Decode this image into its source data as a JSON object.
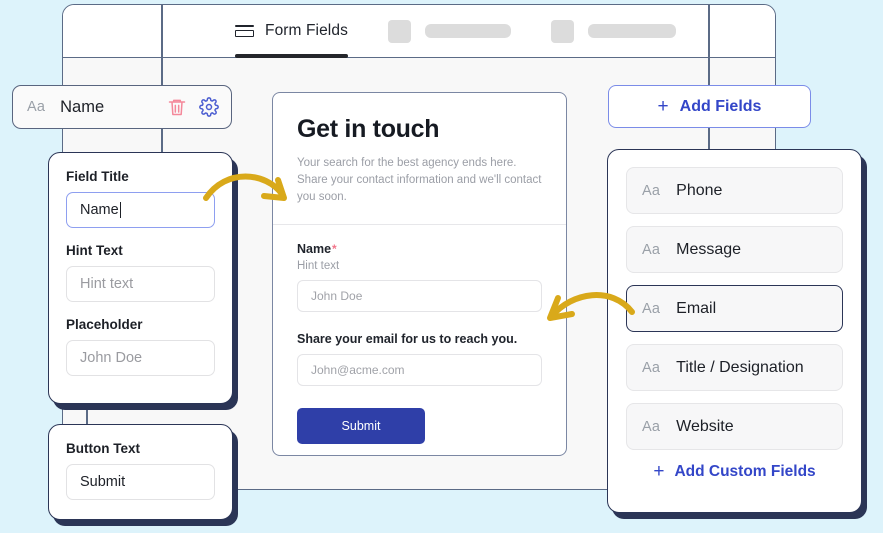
{
  "app": {
    "tabs": [
      {
        "label": "Form Fields",
        "icon": "form-icon",
        "active": true
      },
      {
        "label": "",
        "icon": "skeleton",
        "active": false
      },
      {
        "label": "",
        "icon": "skeleton",
        "active": false
      }
    ]
  },
  "field_chip": {
    "type_icon": "Aa",
    "label": "Name",
    "delete_icon": "trash-icon",
    "settings_icon": "gear-icon",
    "delete_color": "#f4889a",
    "settings_color": "#4a5cd0"
  },
  "settings_panel": {
    "field_title_label": "Field Title",
    "field_title_value": "Name",
    "hint_text_label": "Hint Text",
    "hint_text_placeholder": "Hint text",
    "placeholder_label": "Placeholder",
    "placeholder_placeholder": "John Doe"
  },
  "button_panel": {
    "label": "Button Text",
    "value": "Submit"
  },
  "preview": {
    "title": "Get in touch",
    "description": "Your search for the best agency ends here. Share your contact information and we'll contact you soon.",
    "name_label": "Name",
    "required_mark": "*",
    "name_hint": "Hint text",
    "name_placeholder": "John Doe",
    "email_label": "Share your email for us to reach you.",
    "email_placeholder": "John@acme.com",
    "submit_label": "Submit",
    "submit_color": "#2f3fa8"
  },
  "add_fields_button": {
    "plus": "+",
    "label": "Add Fields",
    "color": "#3346c8"
  },
  "fields_panel": {
    "items": [
      {
        "type_icon": "Aa",
        "label": "Phone",
        "selected": false
      },
      {
        "type_icon": "Aa",
        "label": "Message",
        "selected": false
      },
      {
        "type_icon": "Aa",
        "label": "Email",
        "selected": true
      },
      {
        "type_icon": "Aa",
        "label": "Title / Designation",
        "selected": false
      },
      {
        "type_icon": "Aa",
        "label": "Website",
        "selected": false
      }
    ],
    "add_custom": {
      "plus": "+",
      "label": "Add Custom Fields"
    }
  },
  "theme": {
    "background": "#ddf3fb",
    "card_shadow": "#2b3556",
    "arrow_color": "#d9a91a"
  }
}
